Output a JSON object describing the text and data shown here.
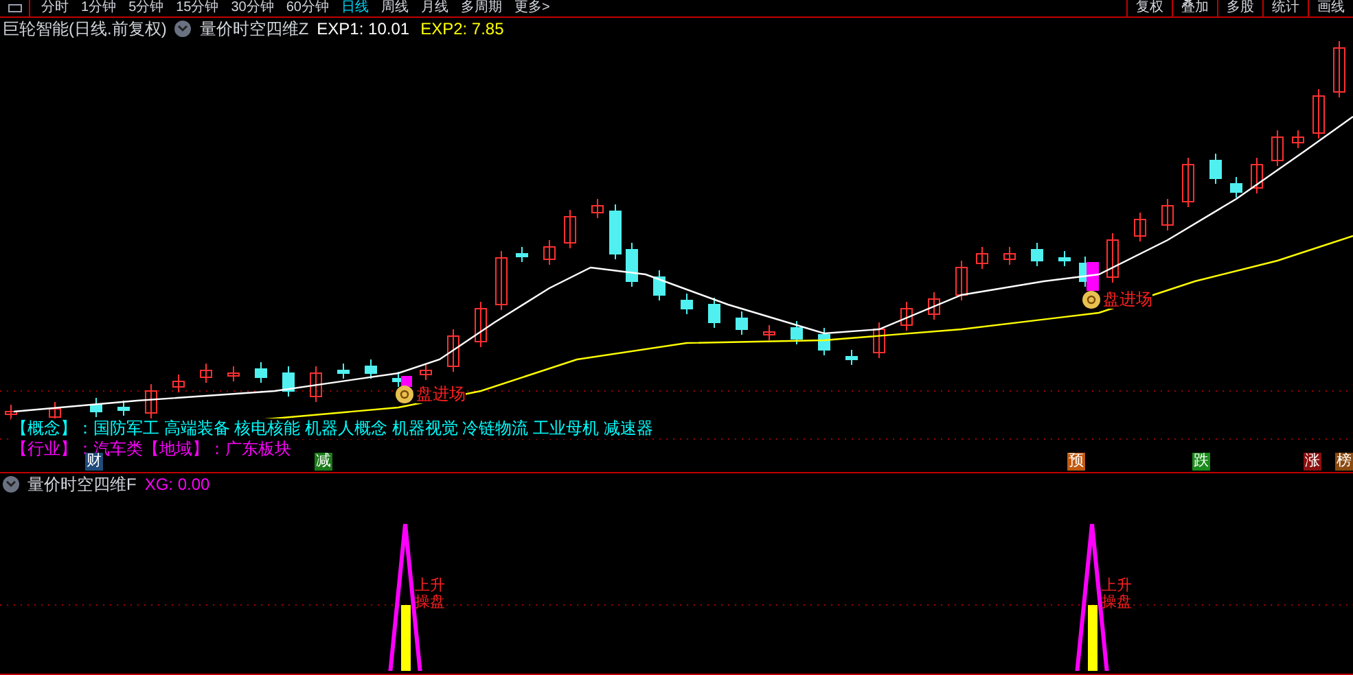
{
  "toolbar": {
    "periods": [
      {
        "label": "分时",
        "selected": false
      },
      {
        "label": "1分钟",
        "selected": false
      },
      {
        "label": "5分钟",
        "selected": false
      },
      {
        "label": "15分钟",
        "selected": false
      },
      {
        "label": "30分钟",
        "selected": false
      },
      {
        "label": "60分钟",
        "selected": false
      },
      {
        "label": "日线",
        "selected": true
      },
      {
        "label": "周线",
        "selected": false
      },
      {
        "label": "月线",
        "selected": false
      },
      {
        "label": "多周期",
        "selected": false
      },
      {
        "label": "更多>",
        "selected": false
      }
    ],
    "buttons": [
      "复权",
      "叠加",
      "多股",
      "统计",
      "画线"
    ]
  },
  "main_panel": {
    "title": "巨轮智能(日线.前复权)",
    "indicator": "量价时空四维Z",
    "values": [
      {
        "text": "EXP1: 10.01",
        "color": "#ffffff"
      },
      {
        "text": "EXP2: 7.85",
        "color": "#ffff00"
      }
    ],
    "signals": [
      {
        "label": "盘进场"
      },
      {
        "label": "盘进场"
      }
    ],
    "info": [
      {
        "text": "【概念】：国防军工 高端装备 核电核能 机器人概念 机器视觉 冷链物流 工业母机 减速器",
        "color": "#00ffff"
      },
      {
        "text": "【行业】：汽车类【地域】：广东板块",
        "color": "#ff00ff"
      }
    ],
    "event_markers": [
      {
        "label": "财",
        "color": "#1f4a7a"
      },
      {
        "label": "减",
        "color": "#1a7a1a"
      },
      {
        "label": "预",
        "color": "#c05a10"
      },
      {
        "label": "跌",
        "color": "#1a8a1a"
      },
      {
        "label": "涨",
        "color": "#8a1010"
      },
      {
        "label": "榜",
        "color": "#8a4a10"
      }
    ]
  },
  "sub_panel": {
    "indicator": "量价时空四维F",
    "values": [
      {
        "text": "XG: 0.00",
        "color": "#ff00ff"
      }
    ],
    "signals": [
      {
        "label": "上升操盘"
      },
      {
        "label": "上升操盘"
      }
    ]
  }
}
